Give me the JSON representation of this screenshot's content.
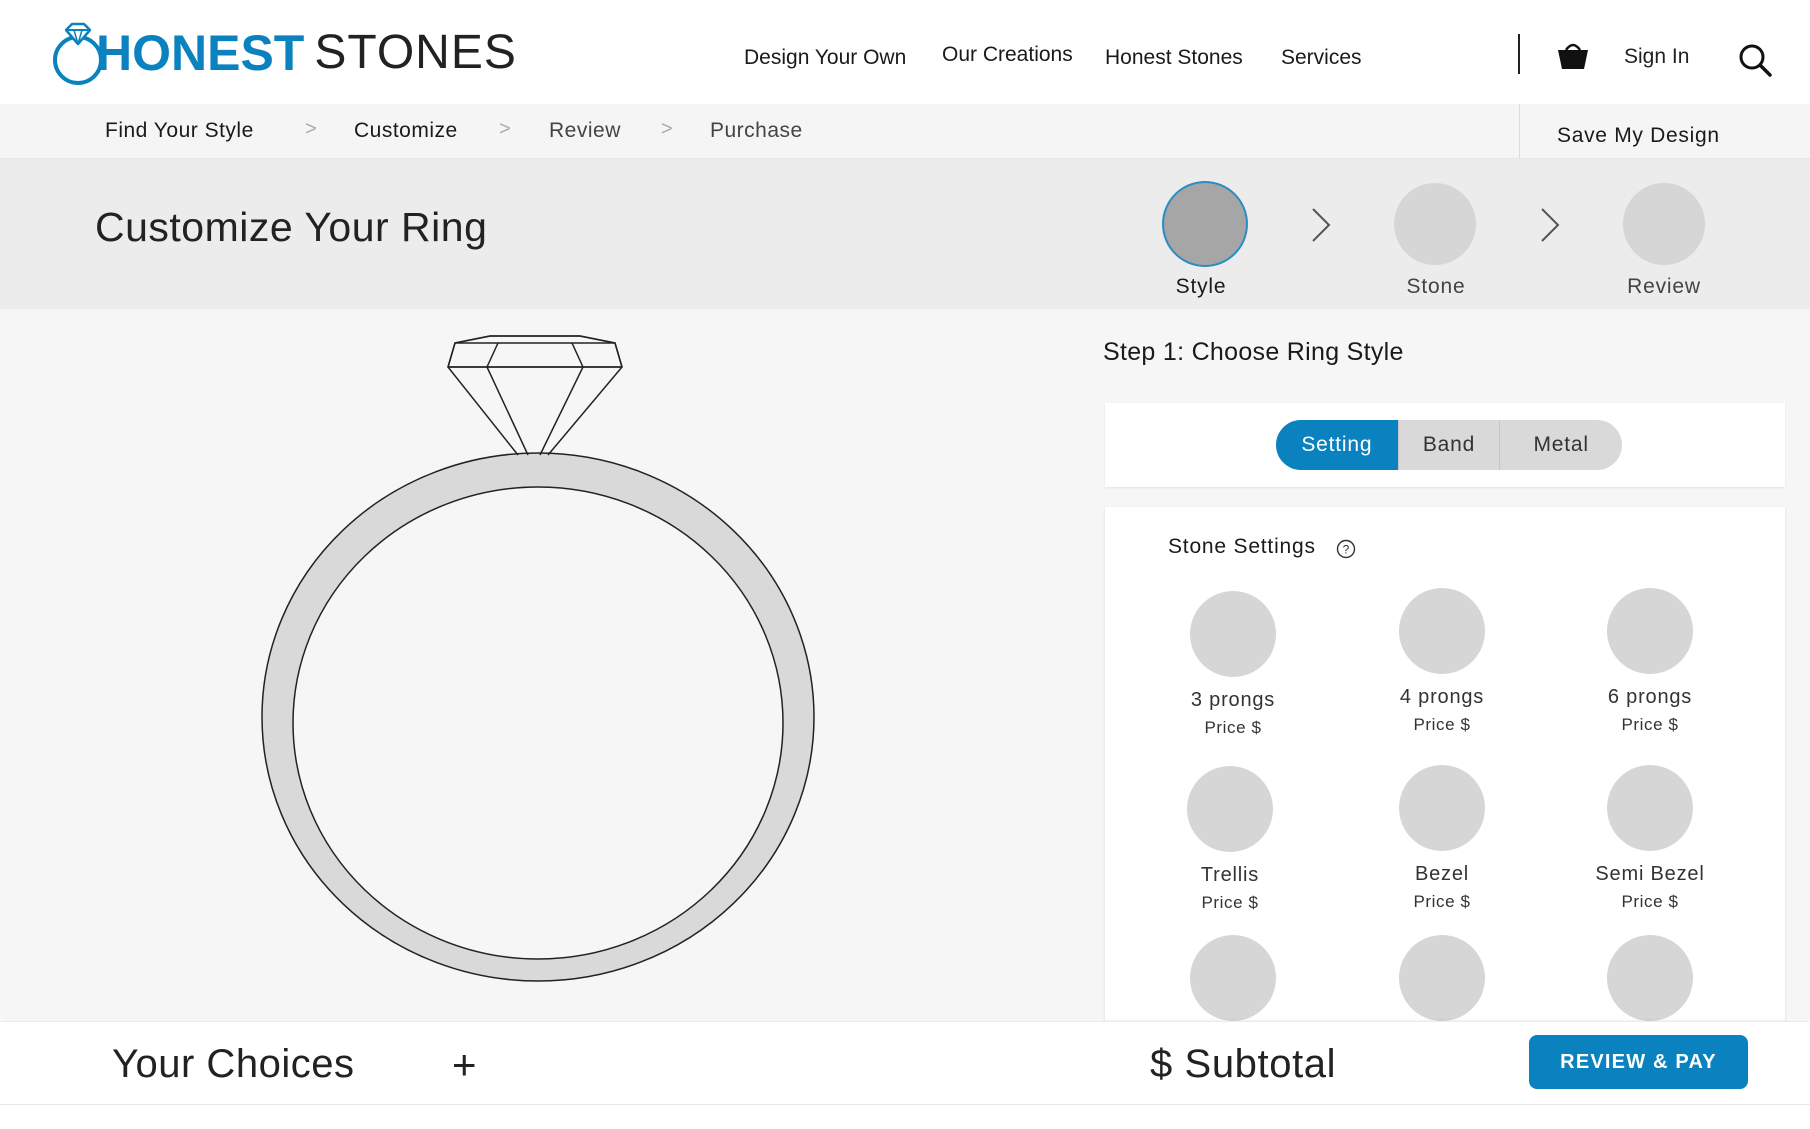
{
  "brand": {
    "name_bold": "HONEST",
    "name_light": "STONES"
  },
  "nav": {
    "items": [
      "Design Your Own",
      "Our Creations",
      "Honest Stones",
      "Services"
    ],
    "sign_in": "Sign In"
  },
  "breadcrumb": {
    "steps": [
      "Find Your Style",
      "Customize",
      "Review",
      "Purchase"
    ],
    "separator": ">",
    "save_design": "Save My Design"
  },
  "page": {
    "title": "Customize Your Ring"
  },
  "stepper": {
    "steps": [
      "Style",
      "Stone",
      "Review"
    ],
    "active": "Style"
  },
  "step_panel": {
    "heading": "Step 1: Choose Ring Style",
    "tabs": [
      "Setting",
      "Band",
      "Metal"
    ],
    "active_tab": "Setting"
  },
  "stone_settings": {
    "title": "Stone Settings",
    "options": [
      {
        "name": "3 prongs",
        "price": "Price $"
      },
      {
        "name": "4 prongs",
        "price": "Price $"
      },
      {
        "name": "6 prongs",
        "price": "Price $"
      },
      {
        "name": "Trellis",
        "price": "Price $"
      },
      {
        "name": "Bezel",
        "price": "Price $"
      },
      {
        "name": "Semi Bezel",
        "price": "Price $"
      }
    ]
  },
  "footer": {
    "your_choices": "Your Choices",
    "expand": "+",
    "subtotal": "$ Subtotal",
    "review_pay": "REVIEW & PAY"
  },
  "colors": {
    "accent": "#0a82bf",
    "placeholder": "#d6d6d6",
    "active_step": "#a6a6a6"
  }
}
